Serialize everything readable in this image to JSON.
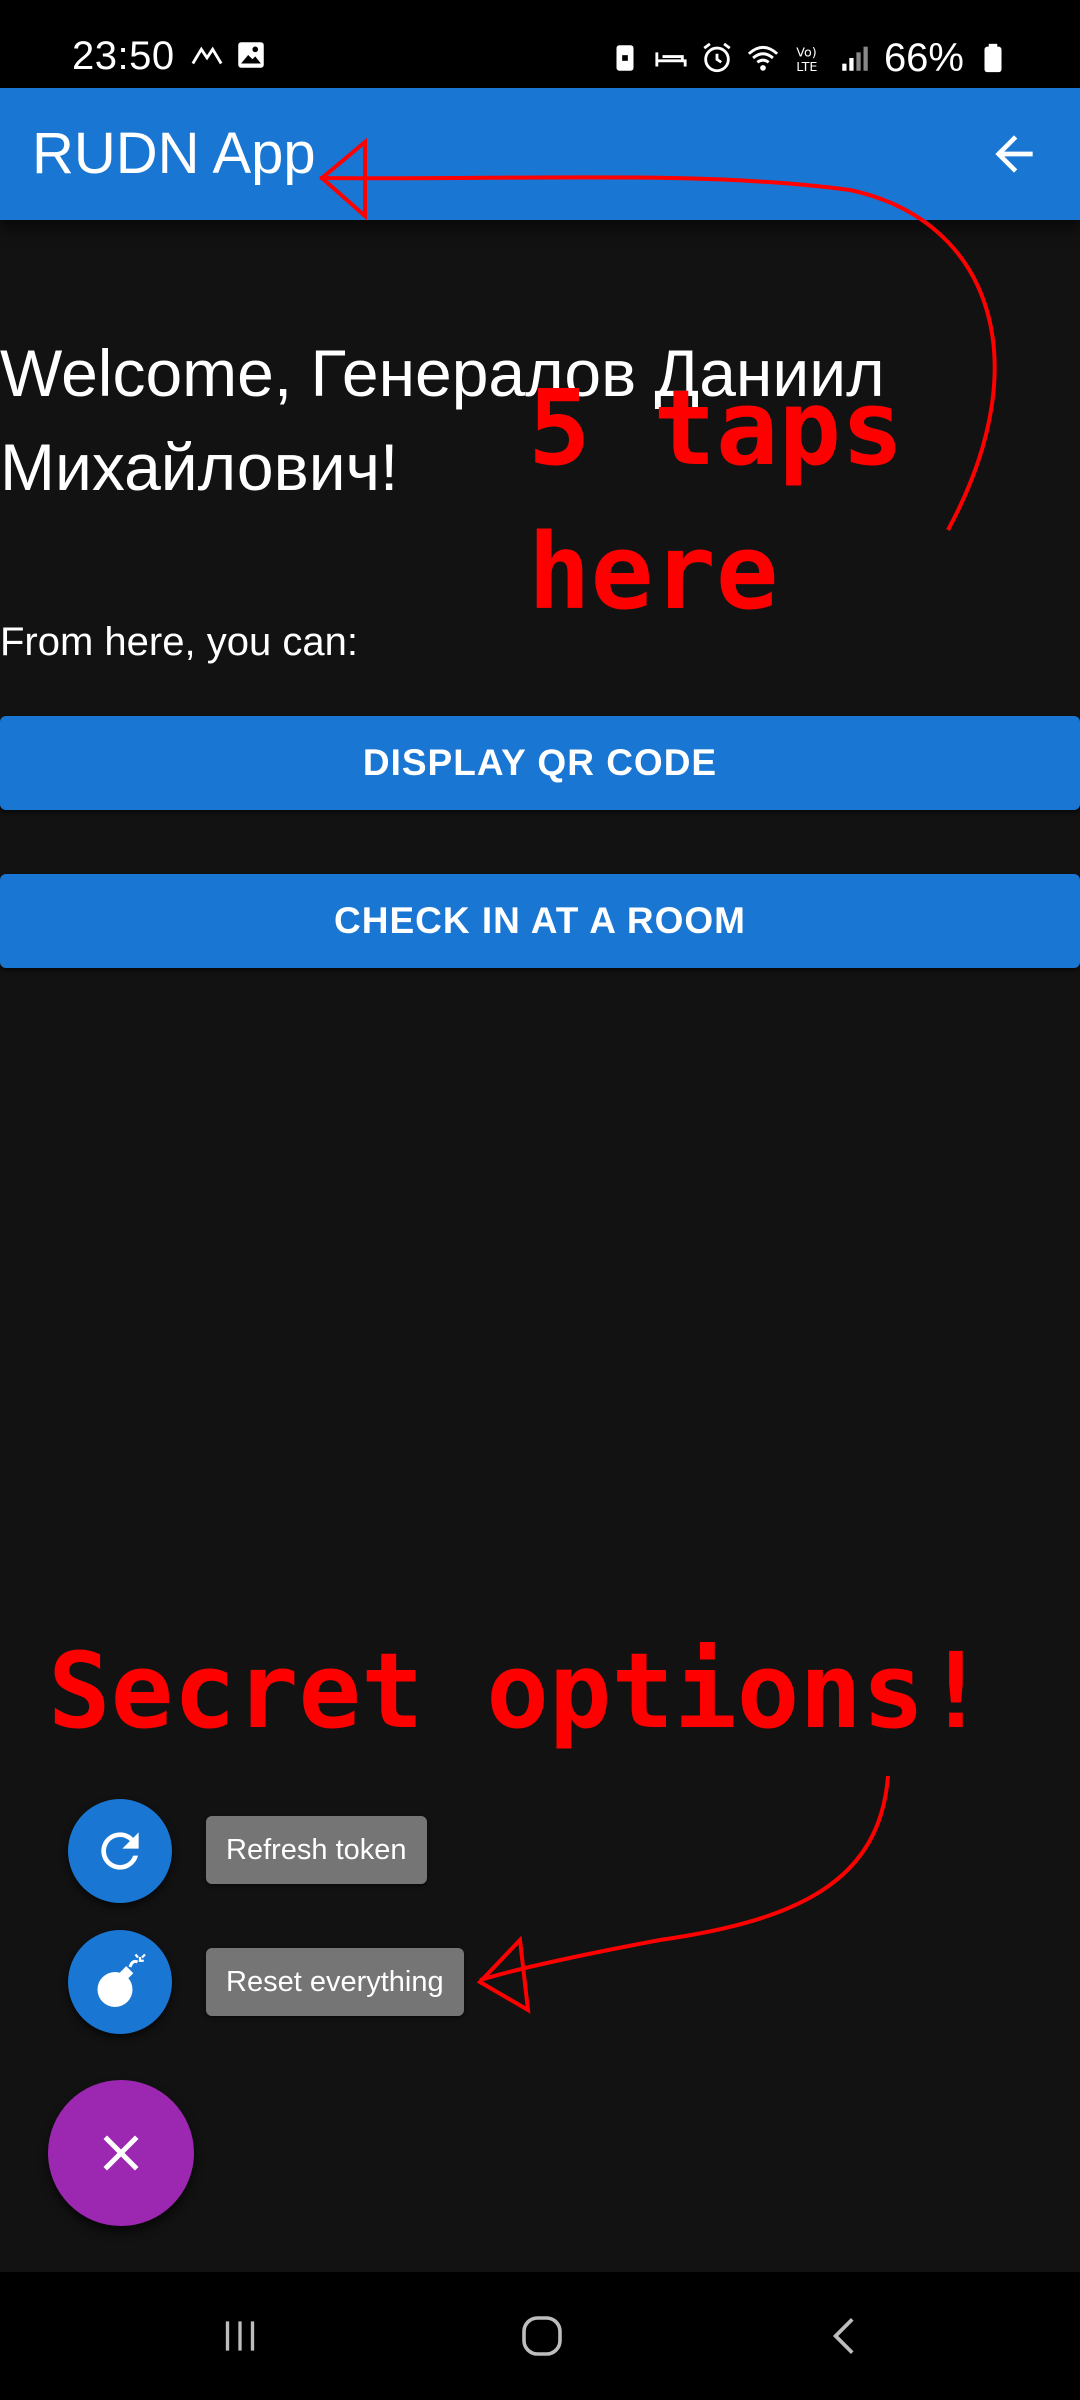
{
  "status_bar": {
    "time": "23:50",
    "battery": "66%",
    "left_icons": [
      "signal-arc-icon",
      "image-icon"
    ],
    "right_icons": [
      "battery-saver-icon",
      "bed-icon",
      "alarm-icon",
      "wifi-icon",
      "volte-icon",
      "cell-signal-icon",
      "battery-icon"
    ]
  },
  "app_bar": {
    "title": "RUDN App",
    "back_icon": "arrow-back-icon",
    "color": "#1976d2"
  },
  "main": {
    "welcome": "Welcome, Генералов Даниил Михайлович!",
    "intro": "From here, you can:",
    "buttons": {
      "display_qr": "DISPLAY QR CODE",
      "check_in": "CHECK IN AT A ROOM"
    }
  },
  "secret_menu": {
    "refresh_label": "Refresh token",
    "refresh_icon": "refresh-icon",
    "reset_label": "Reset everything",
    "reset_icon": "bomb-icon",
    "close_icon": "close-icon",
    "fab_color": "#9c27b0"
  },
  "annotations": {
    "taps": "5 taps\nhere",
    "secret": "Secret options!",
    "color": "#ff0000"
  },
  "nav_bar": {
    "icons": [
      "recents-icon",
      "home-icon",
      "back-icon"
    ]
  }
}
